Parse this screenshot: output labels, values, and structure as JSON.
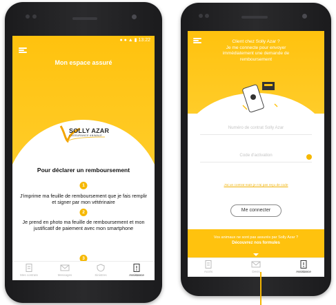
{
  "status_bar": {
    "time": "13:22"
  },
  "left_screen": {
    "header_title": "Mon espace assuré",
    "logo": {
      "name": "SOLLY AZAR",
      "tagline": "L'ASSURANCE ANIMALE"
    },
    "section_title": "Pour déclarer un remboursement",
    "steps": [
      {
        "num": "1",
        "text": "J'imprime ma feuille de remboursement que je fais remplir et signer par mon vétérinaire"
      },
      {
        "num": "2",
        "text": "Je prend en photo ma feuille de remboursement et mon justificatif de paiement avec mon smartphone"
      },
      {
        "num": "3",
        "text": ""
      }
    ],
    "nav": [
      {
        "label": "Mes contrats",
        "icon": "document-icon",
        "active": false
      },
      {
        "label": "Messages",
        "icon": "mail-icon",
        "active": false
      },
      {
        "label": "Sinistres",
        "icon": "shield-icon",
        "active": false
      },
      {
        "label": "Assistance",
        "icon": "assistance-icon",
        "active": true
      }
    ]
  },
  "right_screen": {
    "header_text": "Client chez Solly Azar ?\nJe me connecte pour envoyer\nimmédiatement une demande de\nremboursement",
    "contract_placeholder": "Numéro de contrat Solly Azar",
    "activation_placeholder": "Code d'activation",
    "link_text": "J'ai un contrat mais je n'ai pas reçu de code",
    "connect_button": "Me connecter",
    "promo_line1": "Vos animaux ne sont pas assurés par Solly Azar ?",
    "promo_line2": "Découvrez nos formules",
    "nav": [
      {
        "label": "Accès",
        "icon": "document-icon",
        "active": false
      },
      {
        "label": "Devis",
        "icon": "mail-icon",
        "active": false
      },
      {
        "label": "Assistance",
        "icon": "assistance-icon",
        "active": true
      }
    ]
  },
  "colors": {
    "brand_yellow": "#ffc20e",
    "accent": "#f6b800"
  }
}
